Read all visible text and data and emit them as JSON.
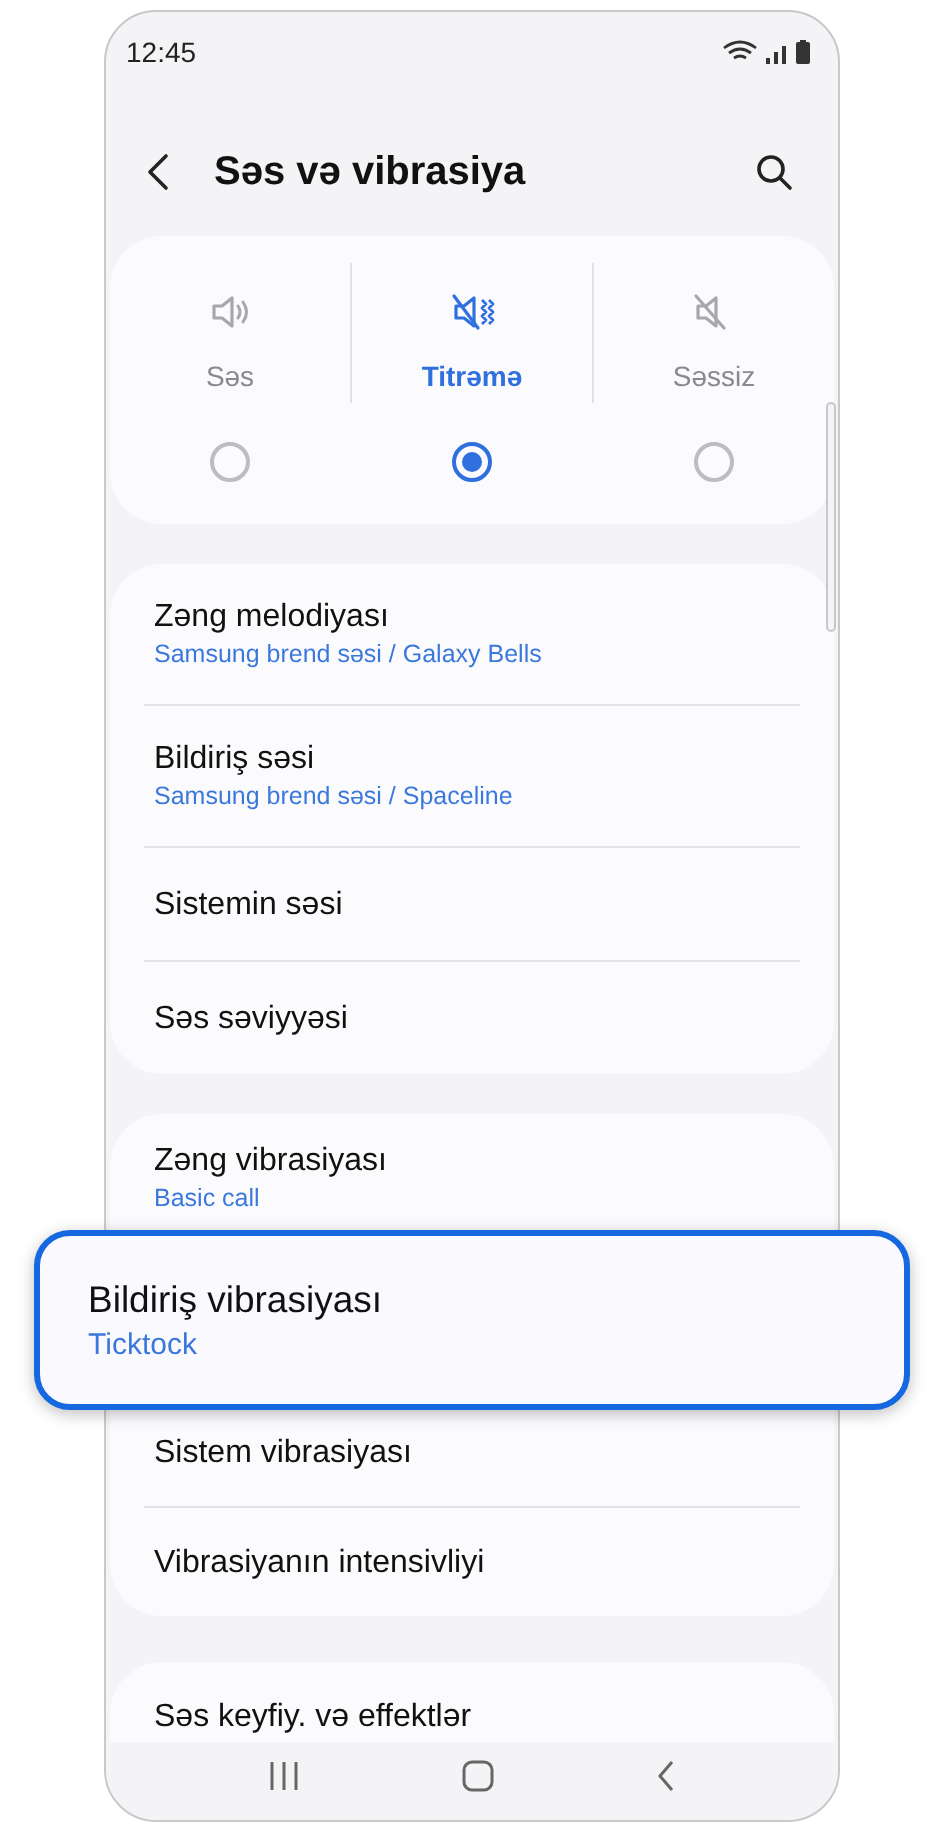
{
  "status_bar": {
    "time": "12:45"
  },
  "header": {
    "title": "Səs və vibrasiya"
  },
  "modes": [
    {
      "kind": "sound",
      "label": "Səs",
      "selected": false
    },
    {
      "kind": "vibrate",
      "label": "Titrəmə",
      "selected": true
    },
    {
      "kind": "mute",
      "label": "Səssiz",
      "selected": false
    }
  ],
  "sound_items": [
    {
      "title": "Zəng melodiyası",
      "subtitle": "Samsung brend səsi / Galaxy Bells"
    },
    {
      "title": "Bildiriş səsi",
      "subtitle": "Samsung brend səsi / Spaceline"
    },
    {
      "title": "Sistemin səsi"
    },
    {
      "title": "Səs səviyyəsi"
    }
  ],
  "vibration_items": [
    {
      "title": "Zəng vibrasiyası",
      "subtitle": "Basic call",
      "highlighted": false
    },
    {
      "title": "Bildiriş vibrasiyası",
      "subtitle": "Ticktock",
      "highlighted": true
    },
    {
      "title": "Sistem vibrasiyası",
      "highlighted": false
    },
    {
      "title": "Vibrasiyanın intensivliyi",
      "highlighted": false
    }
  ],
  "more_items": [
    {
      "title": "Səs keyfiy. və effektlər"
    }
  ]
}
